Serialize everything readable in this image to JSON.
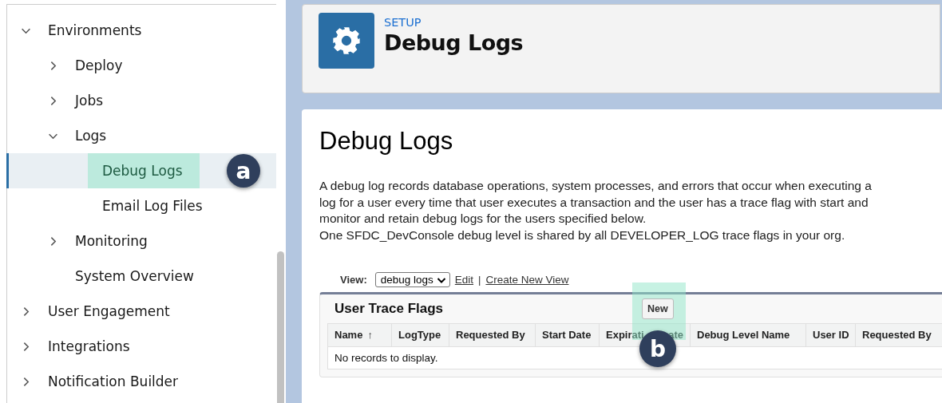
{
  "sidebar": {
    "items": [
      {
        "label": "Environments",
        "expanded": true,
        "selected": false,
        "children": [
          {
            "label": "Deploy",
            "expanded": false,
            "selected": false
          },
          {
            "label": "Jobs",
            "expanded": false,
            "selected": false
          },
          {
            "label": "Logs",
            "expanded": true,
            "selected": false,
            "children": [
              {
                "label": "Debug Logs",
                "selected": true,
                "callout": "a"
              },
              {
                "label": "Email Log Files",
                "selected": false
              }
            ]
          },
          {
            "label": "Monitoring",
            "expanded": false,
            "selected": false
          },
          {
            "label": "System Overview",
            "selected": false
          }
        ]
      },
      {
        "label": "User Engagement",
        "expanded": false,
        "selected": false
      },
      {
        "label": "Integrations",
        "expanded": false,
        "selected": false
      },
      {
        "label": "Notification Builder",
        "expanded": false,
        "selected": false
      }
    ]
  },
  "header": {
    "eyebrow": "SETUP",
    "title": "Debug Logs"
  },
  "page": {
    "title": "Debug Logs",
    "description_lines": [
      "A debug log records database operations, system processes, and errors that occur when executing a",
      "log for a user every time that user executes a transaction and the user has a trace flag with start and",
      "monitor and retain debug logs for the users specified below.",
      "One SFDC_DevConsole debug level is shared by all DEVELOPER_LOG trace flags in your org."
    ],
    "view": {
      "label": "View:",
      "value": "debug logs",
      "links": [
        "Edit",
        "Create New View"
      ],
      "separator": "|"
    }
  },
  "table": {
    "title": "User Trace Flags",
    "new_button": {
      "label": "New",
      "callout": "b"
    },
    "columns": [
      {
        "label": "Name",
        "sort": "↑"
      },
      {
        "label": "LogType"
      },
      {
        "label": "Requested By"
      },
      {
        "label": "Start Date"
      },
      {
        "parts": [
          "Expirati",
          "ate"
        ]
      },
      {
        "label": "Debug Level Name"
      },
      {
        "label": "User ID"
      },
      {
        "label": "Requested By"
      }
    ],
    "empty_message": "No records to display."
  }
}
